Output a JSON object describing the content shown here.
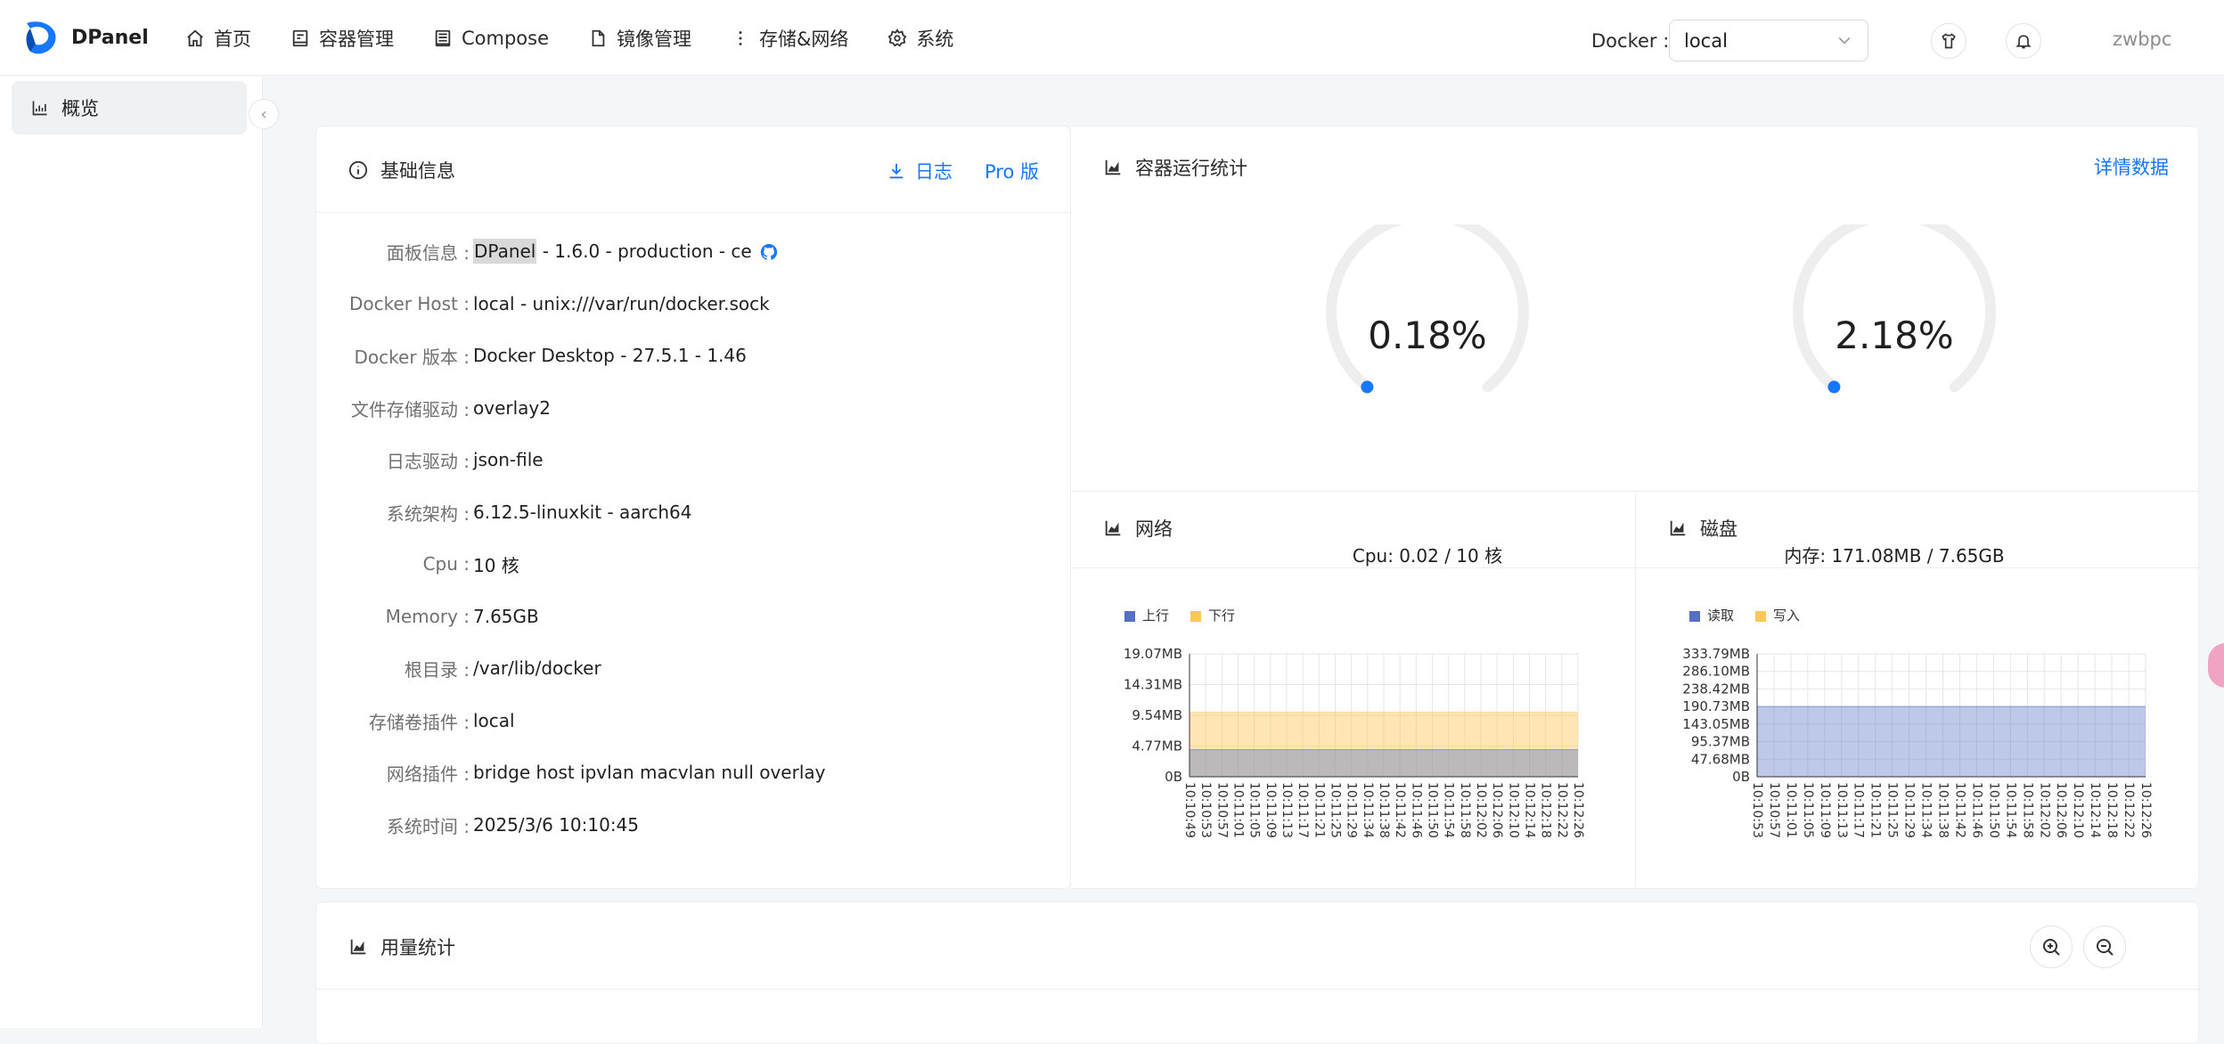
{
  "app": {
    "brand": "DPanel",
    "user": "zwbpc"
  },
  "nav": [
    {
      "label": "首页",
      "icon": "home-icon"
    },
    {
      "label": "容器管理",
      "icon": "container-icon"
    },
    {
      "label": "Compose",
      "icon": "compose-icon"
    },
    {
      "label": "镜像管理",
      "icon": "image-icon"
    },
    {
      "label": "存储&网络",
      "icon": "more-icon"
    },
    {
      "label": "系统",
      "icon": "gear-icon"
    }
  ],
  "docker": {
    "label": "Docker :",
    "selected": "local"
  },
  "sidebar": {
    "items": [
      {
        "label": "概览",
        "icon": "chart-icon"
      }
    ]
  },
  "basic": {
    "title": "基础信息",
    "log_label": "日志",
    "pro_label": "Pro 版",
    "rows": [
      {
        "k": "面板信息 :",
        "v": "DPanel -  1.6.0  -  production  -  ce"
      },
      {
        "k": "Docker Host :",
        "v": "local - unix:///var/run/docker.sock"
      },
      {
        "k": "Docker 版本 :",
        "v": "Docker Desktop - 27.5.1 - 1.46"
      },
      {
        "k": "文件存储驱动 :",
        "v": "overlay2"
      },
      {
        "k": "日志驱动 :",
        "v": "json-file"
      },
      {
        "k": "系统架构 :",
        "v": "6.12.5-linuxkit - aarch64"
      },
      {
        "k": "Cpu :",
        "v": "10 核"
      },
      {
        "k": "Memory :",
        "v": "7.65GB"
      },
      {
        "k": "根目录 :",
        "v": "/var/lib/docker"
      },
      {
        "k": "存储卷插件 :",
        "v": "local"
      },
      {
        "k": "网络插件 :",
        "v": "bridge  host  ipvlan  macvlan  null  overlay"
      },
      {
        "k": "系统时间 :",
        "v": "2025/3/6 10:10:45"
      }
    ],
    "panel_name": "DPanel",
    "panel_rest": " -  1.6.0  -  production  -  ce"
  },
  "stats": {
    "title": "容器运行统计",
    "detail_label": "详情数据",
    "cpu": {
      "value": "0.18%",
      "percent": 0.18,
      "caption": "Cpu: 0.02 / 10 核"
    },
    "mem": {
      "value": "2.18%",
      "percent": 2.18,
      "caption": "内存: 171.08MB / 7.65GB"
    },
    "network_title": "网络",
    "disk_title": "磁盘"
  },
  "chart_data": [
    {
      "type": "area",
      "title": "网络",
      "legend": [
        "上行",
        "下行"
      ],
      "yticks": [
        "19.07MB",
        "14.31MB",
        "9.54MB",
        "4.77MB",
        "0B"
      ],
      "ylim_mb": [
        0,
        19.07
      ],
      "x": [
        "10:10:49",
        "10:10:53",
        "10:10:57",
        "10:11:01",
        "10:11:05",
        "10:11:09",
        "10:11:13",
        "10:11:17",
        "10:11:21",
        "10:11:25",
        "10:11:29",
        "10:11:34",
        "10:11:38",
        "10:11:42",
        "10:11:46",
        "10:11:50",
        "10:11:54",
        "10:11:58",
        "10:12:02",
        "10:12:06",
        "10:12:10",
        "10:12:14",
        "10:12:18",
        "10:12:22",
        "10:12:26"
      ],
      "series": [
        {
          "name": "上行",
          "color": "#5470c6",
          "value_mb": 4.2
        },
        {
          "name": "下行",
          "color": "#fac858",
          "value_mb": 10.0
        }
      ]
    },
    {
      "type": "area",
      "title": "磁盘",
      "legend": [
        "读取",
        "写入"
      ],
      "yticks": [
        "333.79MB",
        "286.10MB",
        "238.42MB",
        "190.73MB",
        "143.05MB",
        "95.37MB",
        "47.68MB",
        "0B"
      ],
      "ylim_mb": [
        0,
        333.79
      ],
      "x": [
        "10:10:53",
        "10:10:57",
        "10:11:01",
        "10:11:05",
        "10:11:09",
        "10:11:13",
        "10:11:17",
        "10:11:21",
        "10:11:25",
        "10:11:29",
        "10:11:34",
        "10:11:38",
        "10:11:42",
        "10:11:46",
        "10:11:50",
        "10:11:54",
        "10:11:58",
        "10:12:02",
        "10:12:06",
        "10:12:10",
        "10:12:14",
        "10:12:18",
        "10:12:22",
        "10:12:26"
      ],
      "series": [
        {
          "name": "读取",
          "color": "#5470c6",
          "value_mb": 190.73
        },
        {
          "name": "写入",
          "color": "#fac858",
          "value_mb": 0
        }
      ]
    }
  ],
  "usage": {
    "title": "用量统计"
  }
}
